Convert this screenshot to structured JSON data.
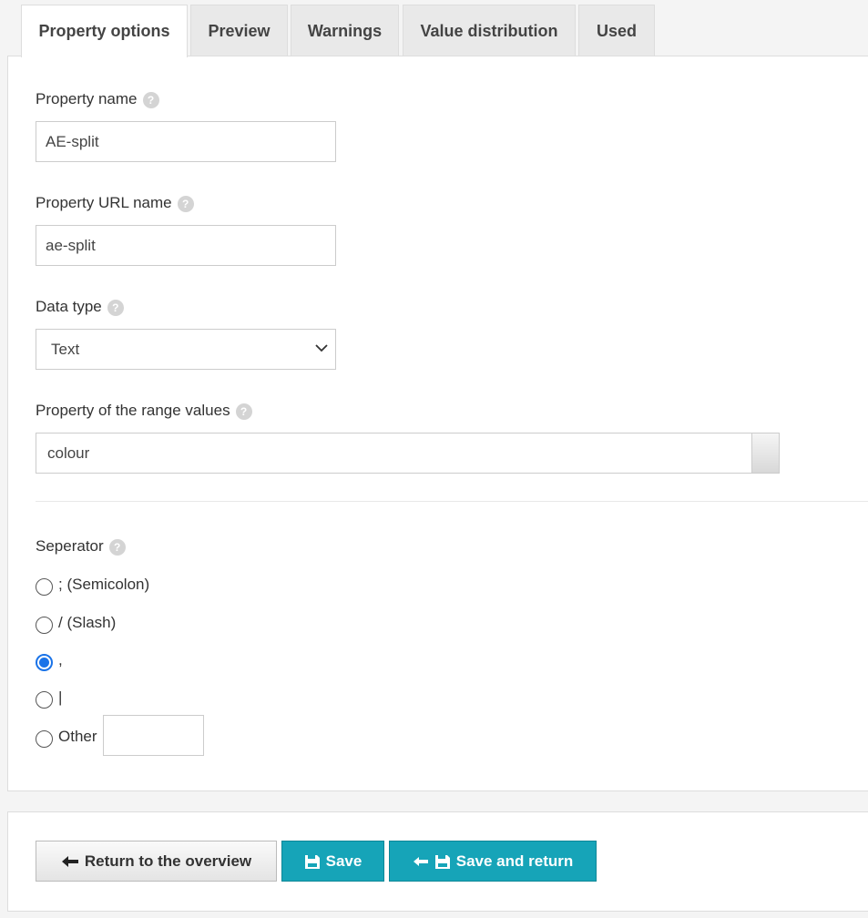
{
  "tabs": [
    {
      "label": "Property options",
      "active": true
    },
    {
      "label": "Preview",
      "active": false
    },
    {
      "label": "Warnings",
      "active": false
    },
    {
      "label": "Value distribution",
      "active": false
    },
    {
      "label": "Used",
      "active": false
    }
  ],
  "form": {
    "property_name": {
      "label": "Property name",
      "value": "AE-split"
    },
    "property_url_name": {
      "label": "Property URL name",
      "value": "ae-split"
    },
    "data_type": {
      "label": "Data type",
      "selected": "Text"
    },
    "range_property": {
      "label": "Property of the range values",
      "value": "colour"
    },
    "separator": {
      "label": "Seperator",
      "options": [
        {
          "label": "; (Semicolon)",
          "checked": false
        },
        {
          "label": "/ (Slash)",
          "checked": false
        },
        {
          "label": ",",
          "checked": true
        },
        {
          "label": "|",
          "checked": false
        },
        {
          "label": "Other",
          "checked": false
        }
      ],
      "other_value": ""
    },
    "help_icon": "?"
  },
  "footer": {
    "return_label": "Return to the overview",
    "save_label": "Save",
    "save_return_label": "Save and return"
  },
  "icons": {
    "help": "help-icon",
    "chevron": "chevron-down-icon",
    "back": "arrow-left-icon",
    "save": "floppy-icon"
  },
  "colors": {
    "accent": "#16a4b8",
    "radio_checked": "#1a73e8"
  }
}
